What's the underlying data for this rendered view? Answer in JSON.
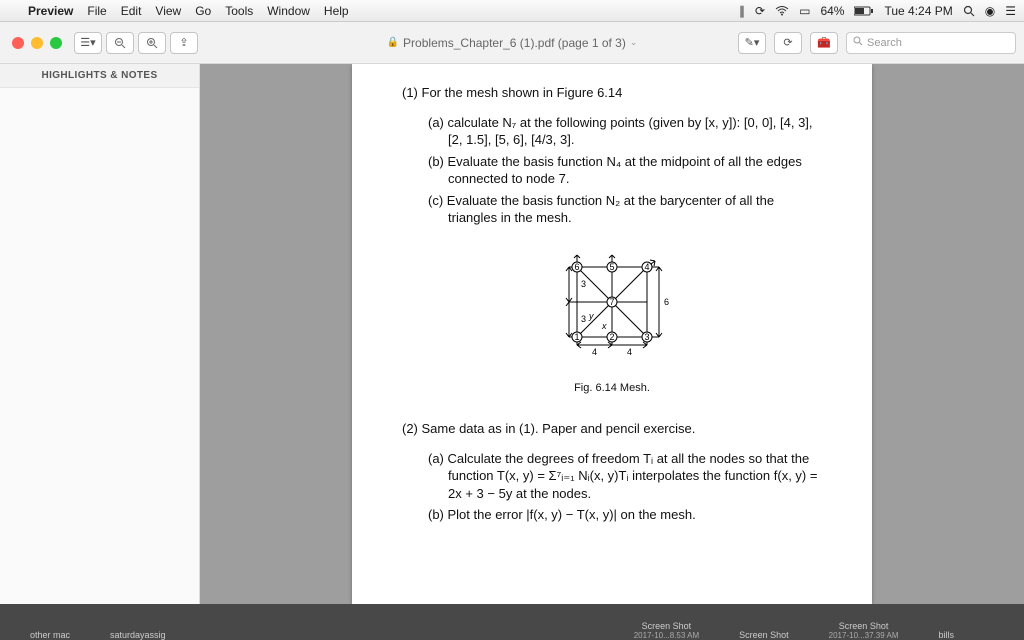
{
  "menubar": {
    "app": "Preview",
    "items": [
      "File",
      "Edit",
      "View",
      "Go",
      "Tools",
      "Window",
      "Help"
    ],
    "battery": "64%",
    "clock": "Tue 4:24 PM"
  },
  "window": {
    "title": "Problems_Chapter_6 (1).pdf (page 1 of 3)",
    "sidebar_tab": "HIGHLIGHTS & NOTES",
    "search_placeholder": "Search"
  },
  "doc": {
    "q1": "(1) For the mesh shown in Figure 6.14",
    "q1a": "(a) calculate N₇ at the following points (given by [x, y]): [0, 0], [4, 3], [2, 1.5], [5, 6], [4/3, 3].",
    "q1b": "(b) Evaluate the basis function N₄ at the midpoint of all the edges connected to node 7.",
    "q1c": "(c) Evaluate the basis function N₂ at the barycenter of all the triangles in the mesh.",
    "figcap": "Fig. 6.14   Mesh.",
    "q2": "(2) Same data as in (1). Paper and pencil exercise.",
    "q2a": "(a) Calculate the degrees of freedom Tᵢ at all the nodes so that the function T(x, y) = Σ⁷ᵢ₌₁ Nᵢ(x, y)Tᵢ interpolates the function f(x, y) = 2x + 3 − 5y at the nodes.",
    "q2b": "(b) Plot the error |f(x, y) − T(x, y)| on the mesh.",
    "mesh": {
      "labels": {
        "top_left": "3",
        "left": "3",
        "right": "6",
        "y": "y",
        "x": "x",
        "b1": "4",
        "b2": "4",
        "n1": "1",
        "n2": "2",
        "n3": "3",
        "n4": "4",
        "n5": "5",
        "n6": "6",
        "n7": "7"
      }
    }
  },
  "dock": {
    "items": [
      {
        "name": "other mac",
        "sub": ""
      },
      {
        "name": "saturdayassig",
        "sub": ""
      },
      {
        "name": "Screen Shot",
        "sub": "2017-10...8.53 AM"
      },
      {
        "name": "Screen Shot",
        "sub": ""
      },
      {
        "name": "Screen Shot",
        "sub": "2017-10...37.39 AM"
      },
      {
        "name": "bills",
        "sub": ""
      }
    ]
  }
}
